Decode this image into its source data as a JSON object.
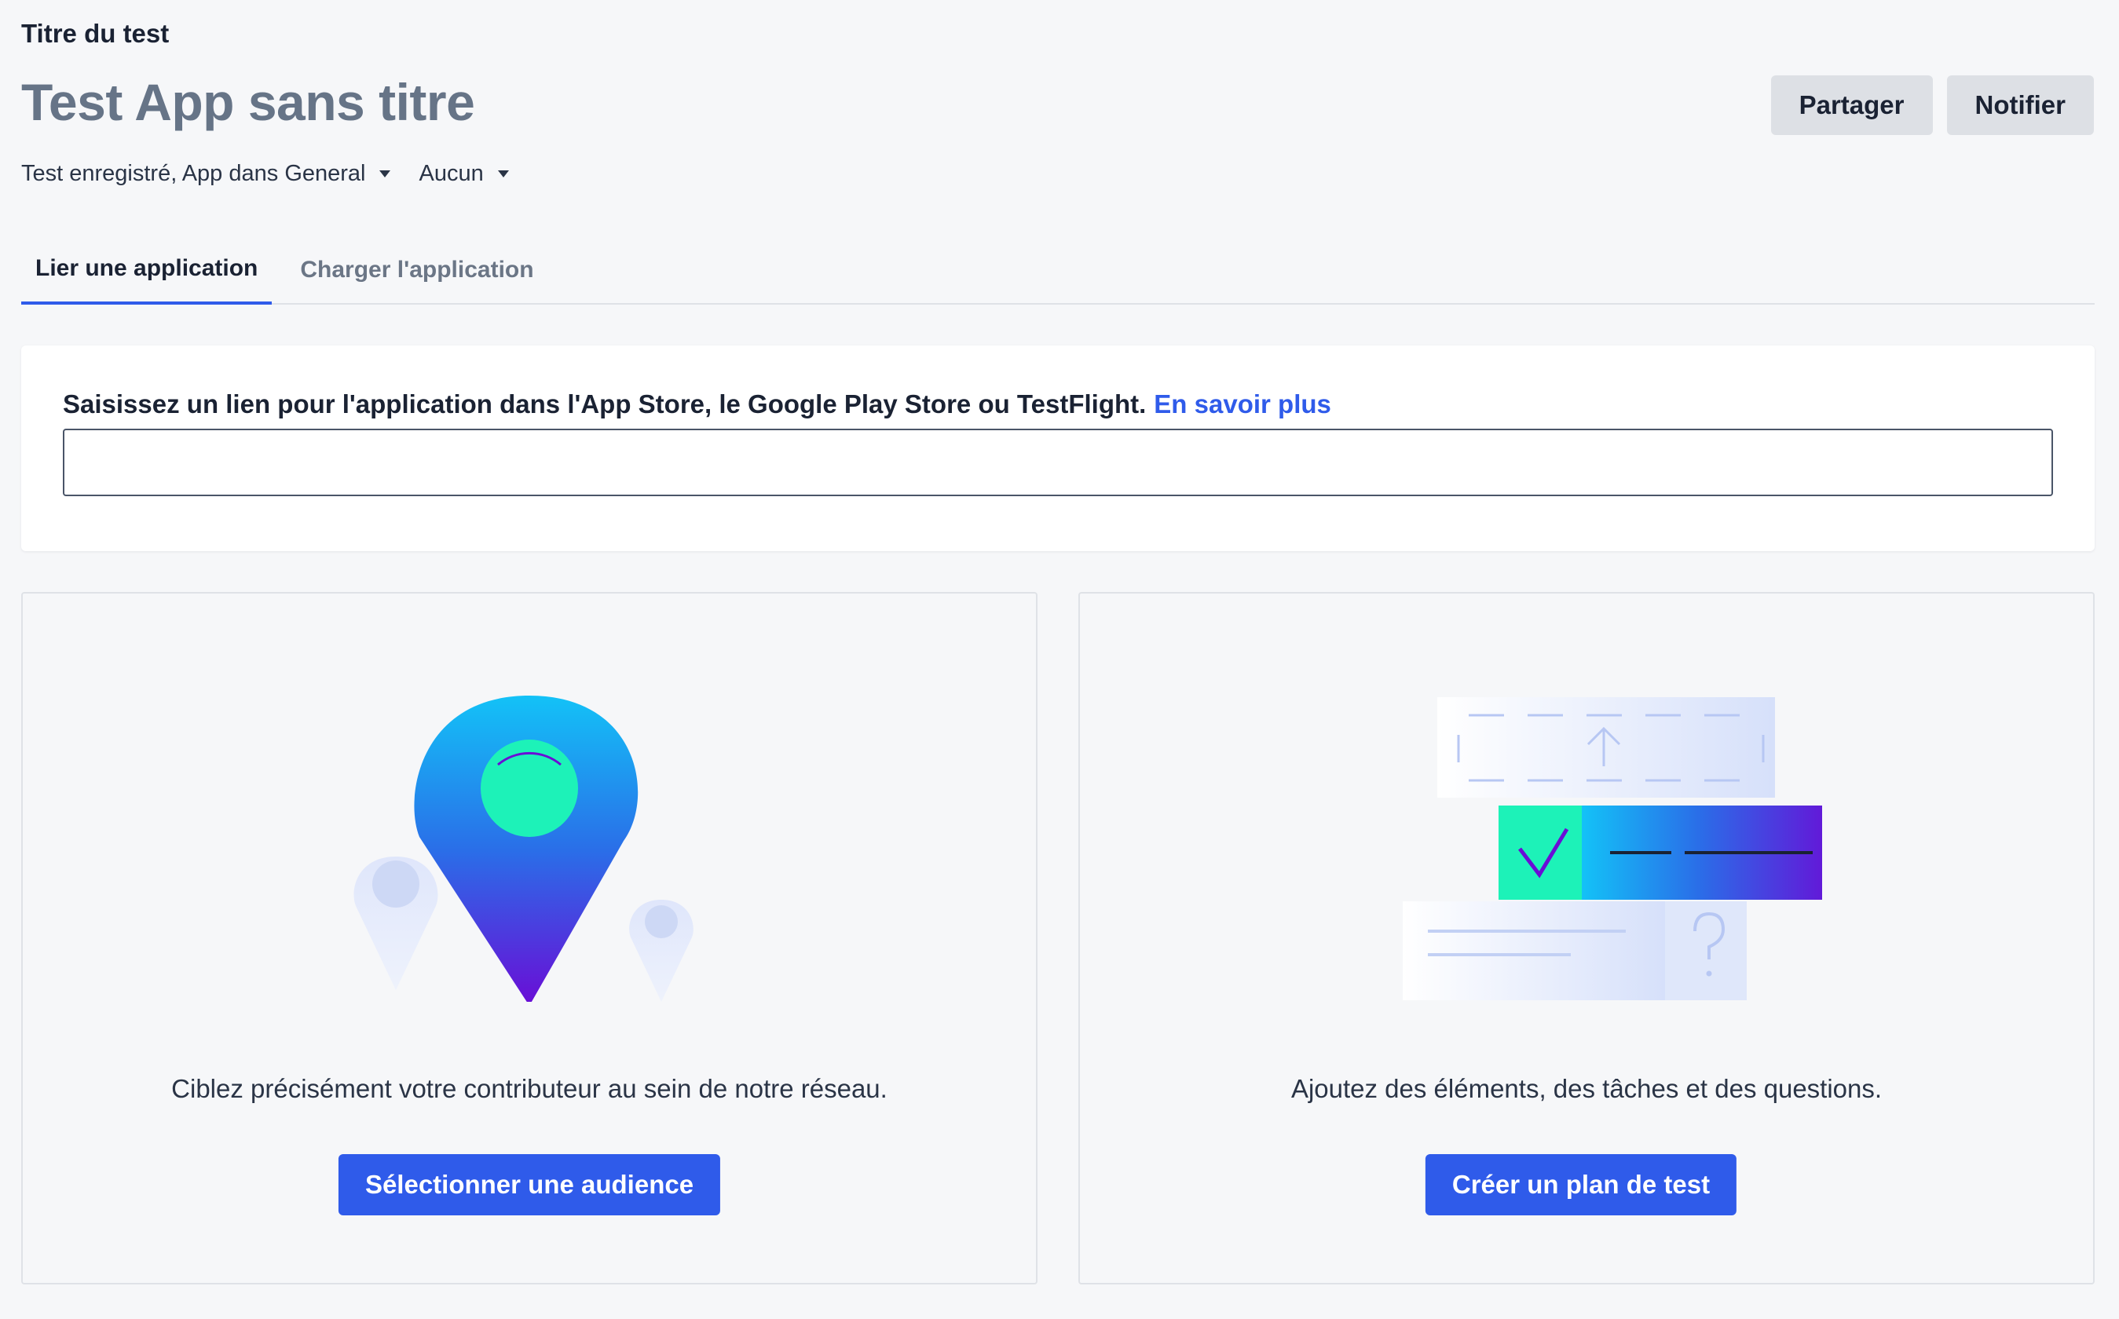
{
  "header": {
    "eyebrow": "Titre du test",
    "title": "Test App sans titre",
    "actions": {
      "share_label": "Partager",
      "notify_label": "Notifier"
    }
  },
  "meta": {
    "status_label": "Test enregistré, App dans General",
    "tag_label": "Aucun"
  },
  "tabs": [
    {
      "label": "Lier une application",
      "active": true
    },
    {
      "label": "Charger l'application",
      "active": false
    }
  ],
  "link_section": {
    "prompt": "Saisissez un lien pour l'application dans l'App Store, le Google Play Store ou TestFlight.",
    "learn_more": "En savoir plus",
    "input_value": "",
    "input_placeholder": ""
  },
  "features": [
    {
      "icon": "location-pins-illustration",
      "description": "Ciblez précisément votre contributeur au sein de notre réseau.",
      "button_label": "Sélectionner une audience"
    },
    {
      "icon": "test-plan-illustration",
      "description": "Ajoutez des éléments, des tâches et des questions.",
      "button_label": "Créer un plan de test"
    }
  ],
  "colors": {
    "accent": "#2f5bea",
    "background": "#f6f7f9",
    "title_gray": "#667487",
    "teal": "#1df2b8",
    "purple": "#6a0dd6",
    "sky": "#13c2f7"
  }
}
